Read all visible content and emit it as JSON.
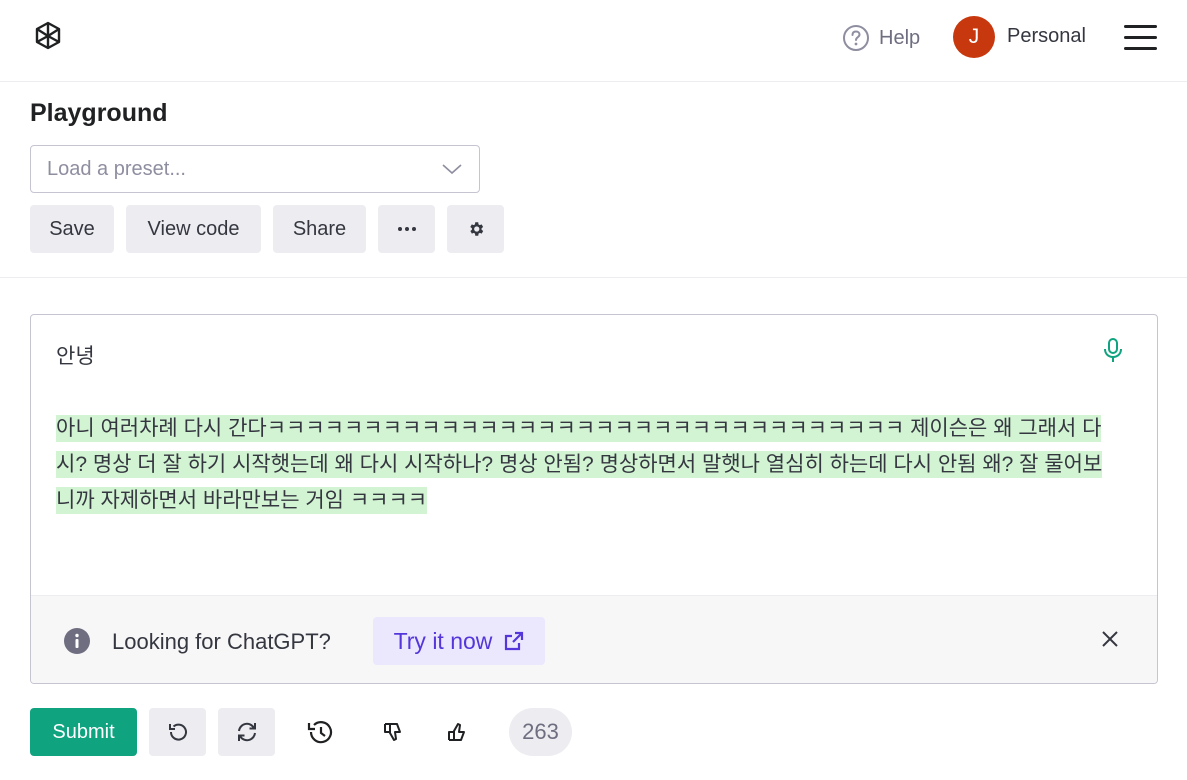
{
  "header": {
    "logo_icon": "openai-logo-icon",
    "help_label": "Help",
    "avatar_initial": "J",
    "account_label": "Personal",
    "menu_icon": "hamburger-menu-icon"
  },
  "page": {
    "title": "Playground"
  },
  "preset": {
    "placeholder": "Load a preset..."
  },
  "toolbar": {
    "save_label": "Save",
    "view_code_label": "View code",
    "share_label": "Share",
    "more_icon": "ellipsis-icon",
    "settings_icon": "gear-icon"
  },
  "editor": {
    "prompt": "안녕",
    "completion": "아니 여러차례 다시 간다ㅋㅋㅋㅋㅋㅋㅋㅋㅋㅋㅋㅋㅋㅋㅋㅋㅋㅋㅋㅋㅋㅋㅋㅋㅋㅋㅋㅋㅋㅋㅋㅋㅋ 제이슨은 왜 그래서 다시? 명상 더 잘 하기 시작햇는데 왜 다시 시작하나? 명상 안됨? 명상하면서 말햇나 열심히 하는데 다시 안됨 왜? 잘 물어보니까 자제하면서 바라만보는 거임 ㅋㅋㅋㅋ",
    "mic_icon": "microphone-icon",
    "highlight_color": "#d2f4d3"
  },
  "banner": {
    "text": "Looking for ChatGPT?",
    "link_label": "Try it now",
    "link_icon": "external-link-icon",
    "close_icon": "close-icon"
  },
  "footer": {
    "submit_label": "Submit",
    "undo_icon": "undo-icon",
    "regenerate_icon": "regenerate-icon",
    "history_icon": "history-icon",
    "thumbs_down_icon": "thumbs-down-icon",
    "thumbs_up_icon": "thumbs-up-icon",
    "token_count": "263"
  },
  "colors": {
    "accent": "#10a37f",
    "link": "#5436da",
    "avatar": "#c8380e"
  }
}
